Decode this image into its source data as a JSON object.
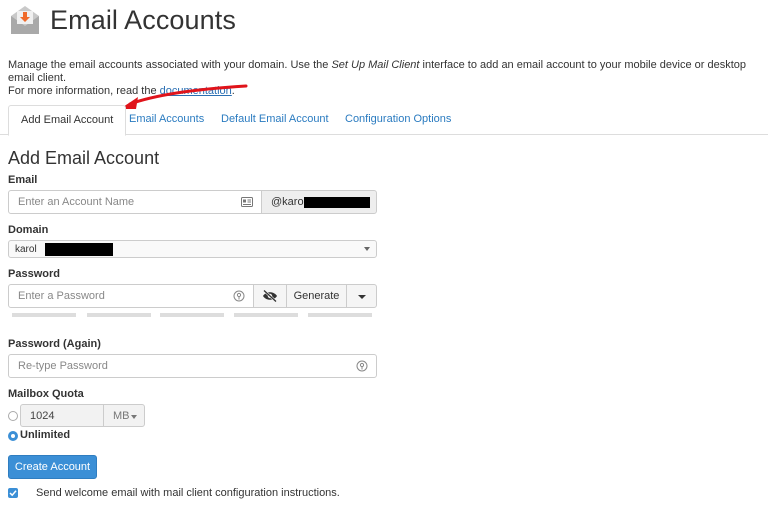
{
  "header": {
    "title": "Email Accounts",
    "icon": "envelope-download-icon"
  },
  "intro": {
    "text_1": "Manage the email accounts associated with your domain. Use the ",
    "emphasis": "Set Up Mail Client",
    "text_2": " interface to add an email account to your mobile device or desktop email client.",
    "text_3": "For more information, read the ",
    "link": "documentation",
    "text_4": "."
  },
  "tabs": [
    {
      "label": "Add Email Account",
      "active": true
    },
    {
      "label": "Email Accounts",
      "active": false
    },
    {
      "label": "Default Email Account",
      "active": false
    },
    {
      "label": "Configuration Options",
      "active": false
    }
  ],
  "form": {
    "section_title": "Add Email Account",
    "email": {
      "label": "Email",
      "placeholder": "Enter an Account Name",
      "domain_prefix": "@karol"
    },
    "domain": {
      "label": "Domain",
      "value_prefix": "karol"
    },
    "password": {
      "label": "Password",
      "placeholder": "Enter a Password",
      "generate_label": "Generate"
    },
    "password_again": {
      "label": "Password (Again)",
      "placeholder": "Re-type Password"
    },
    "quota": {
      "label": "Mailbox Quota",
      "value": "1024",
      "unit": "MB",
      "unlimited_label": "Unlimited"
    },
    "submit_label": "Create Account",
    "welcome_label": "Send welcome email with mail client configuration instructions."
  },
  "colors": {
    "link": "#2a7bc0",
    "primary": "#3b8fd6",
    "arrow": "#e0141b"
  }
}
